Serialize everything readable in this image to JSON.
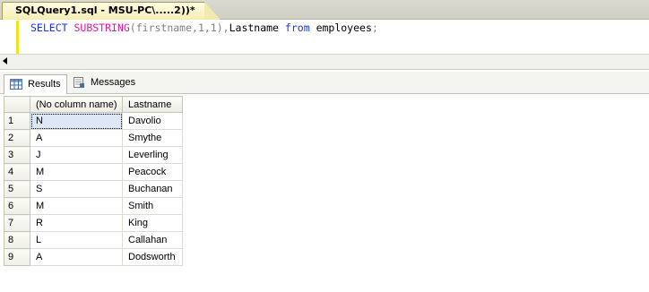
{
  "document_tab": {
    "title": "SQLQuery1.sql - MSU-PC\\.....2))*"
  },
  "editor": {
    "query": {
      "keyword1": "SELECT",
      "function": "SUBSTRING",
      "args": "(firstname,1,1)",
      "comma": ",",
      "column": "Lastname",
      "keyword2": "from",
      "table": "employees",
      "semicolon": ";"
    }
  },
  "result_tabs": [
    {
      "label": "Results",
      "icon": "grid-icon",
      "active": true
    },
    {
      "label": "Messages",
      "icon": "messages-icon",
      "active": false
    }
  ],
  "grid": {
    "columns": [
      "(No column name)",
      "Lastname"
    ],
    "rows": [
      {
        "num": "1",
        "c1": "N",
        "c2": "Davolio"
      },
      {
        "num": "2",
        "c1": "A",
        "c2": "Smythe"
      },
      {
        "num": "3",
        "c1": "J",
        "c2": "Leverling"
      },
      {
        "num": "4",
        "c1": "M",
        "c2": "Peacock"
      },
      {
        "num": "5",
        "c1": "S",
        "c2": "Buchanan"
      },
      {
        "num": "6",
        "c1": "M",
        "c2": "Smith"
      },
      {
        "num": "7",
        "c1": "R",
        "c2": "King"
      },
      {
        "num": "8",
        "c1": "L",
        "c2": "Callahan"
      },
      {
        "num": "9",
        "c1": "A",
        "c2": "Dodsworth"
      }
    ]
  },
  "colors": {
    "keyword": "#1a32ff",
    "function": "#e0169d",
    "change_marker": "#f3e31c"
  }
}
